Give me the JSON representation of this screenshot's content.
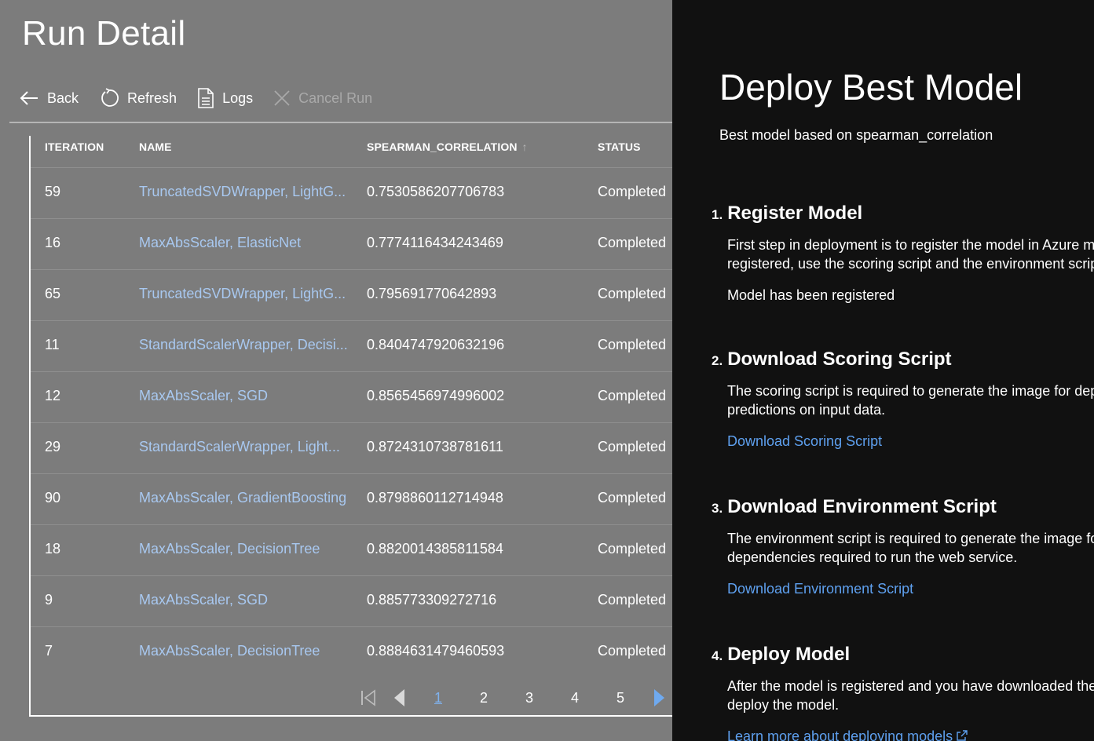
{
  "page": {
    "title": "Run Detail"
  },
  "toolbar": {
    "back_label": "Back",
    "refresh_label": "Refresh",
    "logs_label": "Logs",
    "cancel_label": "Cancel Run"
  },
  "table": {
    "headers": {
      "iteration": "ITERATION",
      "name": "NAME",
      "score": "SPEARMAN_CORRELATION",
      "status": "STATUS"
    },
    "sort_arrow": "↑",
    "rows": [
      {
        "iteration": "59",
        "name": "TruncatedSVDWrapper, LightG...",
        "score": "0.7530586207706783",
        "status": "Completed"
      },
      {
        "iteration": "16",
        "name": "MaxAbsScaler, ElasticNet",
        "score": "0.7774116434243469",
        "status": "Completed"
      },
      {
        "iteration": "65",
        "name": "TruncatedSVDWrapper, LightG...",
        "score": "0.795691770642893",
        "status": "Completed"
      },
      {
        "iteration": "11",
        "name": "StandardScalerWrapper, Decisi...",
        "score": "0.8404747920632196",
        "status": "Completed"
      },
      {
        "iteration": "12",
        "name": "MaxAbsScaler, SGD",
        "score": "0.8565456974996002",
        "status": "Completed"
      },
      {
        "iteration": "29",
        "name": "StandardScalerWrapper, Light...",
        "score": "0.8724310738781611",
        "status": "Completed"
      },
      {
        "iteration": "90",
        "name": "MaxAbsScaler, GradientBoosting",
        "score": "0.8798860112714948",
        "status": "Completed"
      },
      {
        "iteration": "18",
        "name": "MaxAbsScaler, DecisionTree",
        "score": "0.8820014385811584",
        "status": "Completed"
      },
      {
        "iteration": "9",
        "name": "MaxAbsScaler, SGD",
        "score": "0.885773309272716",
        "status": "Completed"
      },
      {
        "iteration": "7",
        "name": "MaxAbsScaler, DecisionTree",
        "score": "0.8884631479460593",
        "status": "Completed"
      }
    ]
  },
  "pager": {
    "pages": [
      "1",
      "2",
      "3",
      "4",
      "5"
    ],
    "current": "1"
  },
  "panel": {
    "title": "Deploy Best Model",
    "subtitle": "Best model based on spearman_correlation",
    "steps": [
      {
        "number": "1.",
        "title": "Register Model",
        "body_line1": "First step in deployment is to register the model in Azure m",
        "body_line2": "registered, use the scoring script and the environment scrip",
        "note": "Model has been registered"
      },
      {
        "number": "2.",
        "title": "Download Scoring Script",
        "body_line1": "The scoring script is required to generate the image for dep",
        "body_line2": "predictions on input data.",
        "link": "Download Scoring Script"
      },
      {
        "number": "3.",
        "title": "Download Environment Script",
        "body_line1": "The environment script is required to generate the image fo",
        "body_line2": "dependencies required to run the web service.",
        "link": "Download Environment Script"
      },
      {
        "number": "4.",
        "title": "Deploy Model",
        "body_line1": "After the model is registered and you have downloaded the",
        "body_line2": "deploy the model.",
        "link": "Learn more about deploying models"
      }
    ]
  },
  "colors": {
    "overlay_gray": "#7c7c7c",
    "panel_bg": "#111111",
    "link_dimmed": "#a8c8f0",
    "link_blue": "#5ea0ef",
    "pager_accent": "#7fb2ee"
  }
}
